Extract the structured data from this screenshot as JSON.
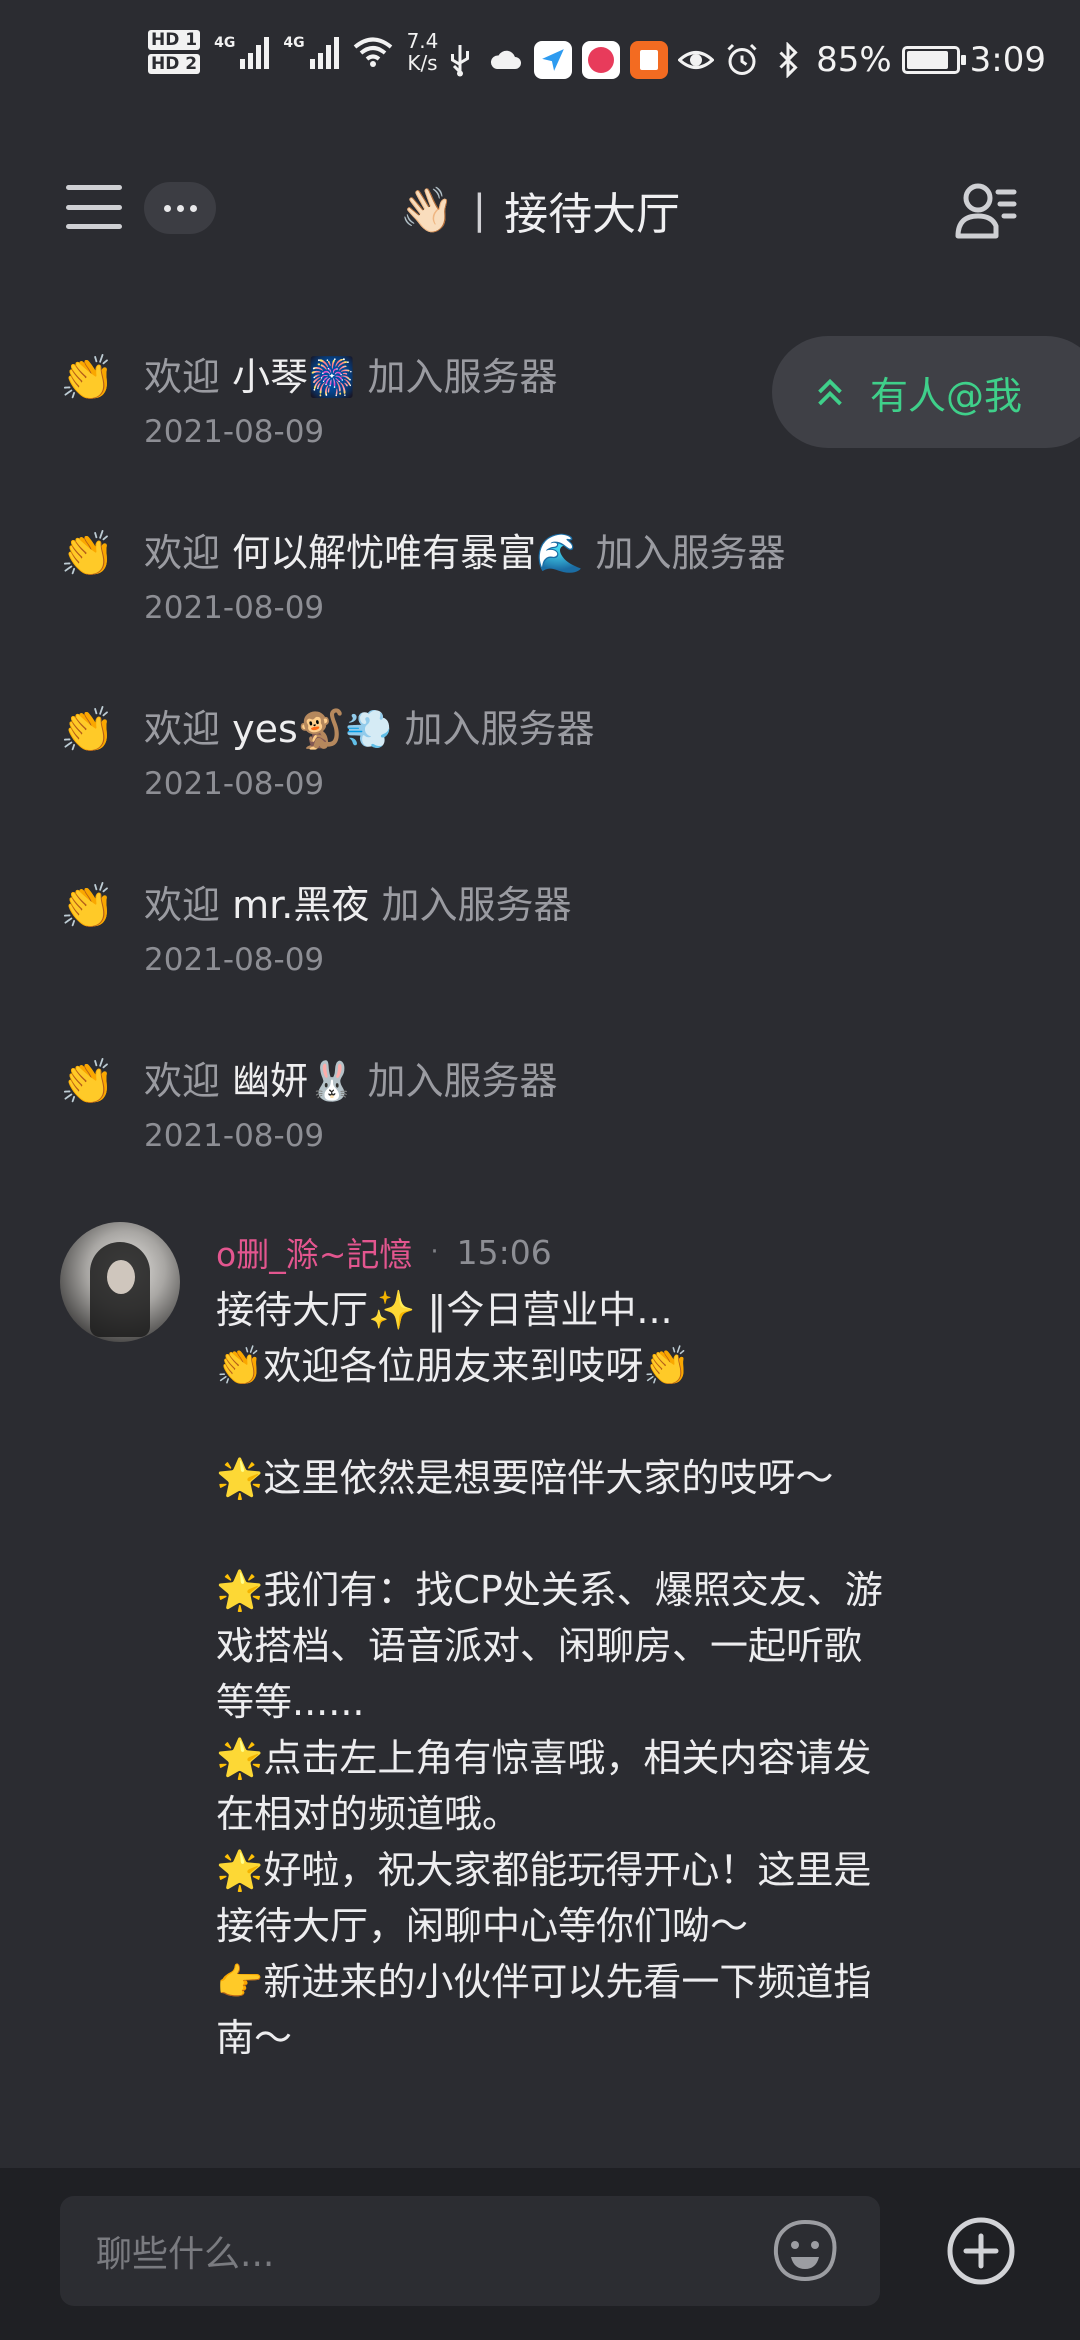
{
  "status_bar": {
    "hd1": "HD 1",
    "hd2": "HD 2",
    "signal1": "4G",
    "signal2": "4G",
    "net_speed_value": "7.4",
    "net_speed_unit": "K/s",
    "battery_percent": "85%",
    "battery_level": 0.85,
    "time": "3:09",
    "icons": [
      "usb-icon",
      "cloud-icon",
      "send-app-icon",
      "red-app-icon",
      "orange-app-icon",
      "eye-icon",
      "alarm-icon",
      "bluetooth-icon"
    ]
  },
  "header": {
    "title_emoji": "👋🏻",
    "separator": "|",
    "title": "接待大厅"
  },
  "mention_pill": {
    "label": "有人@我",
    "color": "#3fd08a"
  },
  "system_messages": [
    {
      "prefix": "欢迎",
      "name": "小琴🎆",
      "suffix": "加入服务器",
      "date": "2021-08-09"
    },
    {
      "prefix": "欢迎",
      "name": "何以解忧唯有暴富🌊",
      "suffix": "加入服务器",
      "date": "2021-08-09"
    },
    {
      "prefix": "欢迎",
      "name": "yes🐒💨",
      "suffix": "加入服务器",
      "date": "2021-08-09"
    },
    {
      "prefix": "欢迎",
      "name": "mr.黑夜",
      "suffix": "加入服务器",
      "date": "2021-08-09"
    },
    {
      "prefix": "欢迎",
      "name": "幽妍🐰",
      "suffix": "加入服务器",
      "date": "2021-08-09"
    }
  ],
  "post": {
    "author": "o删_滁~記憶",
    "author_color": "#e3568f",
    "separator": "·",
    "time": "15:06",
    "lines": [
      "接待大厅✨ ‖今日营业中...",
      " 👏欢迎各位朋友来到吱呀👏",
      "",
      "🌟这里依然是想要陪伴大家的吱呀～",
      "",
      "🌟我们有：找CP处关系、爆照交友、游",
      "戏搭档、语音派对、闲聊房、一起听歌",
      "等等......",
      " 🌟点击左上角有惊喜哦，相关内容请发",
      "在相对的频道哦。",
      "🌟好啦，祝大家都能玩得开心！这里是",
      "接待大厅，闲聊中心等你们呦～",
      "👉新进来的小伙伴可以先看一下频道指",
      "南～"
    ]
  },
  "input": {
    "placeholder": "聊些什么..."
  }
}
